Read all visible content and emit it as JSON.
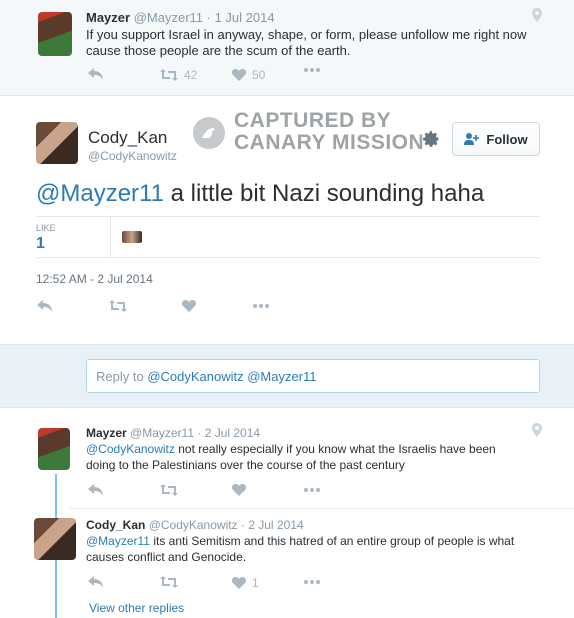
{
  "top_tweet": {
    "name": "Mayzer",
    "handle": "@Mayzer11",
    "date": "· 1 Jul 2014",
    "text_line1": "If you support Israel in anyway, shape, or form, please unfollow me right now",
    "text_line2": "cause those people are the scum of the earth.",
    "retweets": "42",
    "likes": "50"
  },
  "main_tweet": {
    "name": "Cody_Kan",
    "handle": "@CodyKanowitz",
    "watermark_line1": "CAPTURED BY",
    "watermark_line2": "CANARY MISSION",
    "follow_label": "Follow",
    "mention": "@Mayzer11",
    "text": " a little bit Nazi sounding haha",
    "like_label": "LIKE",
    "like_count": "1",
    "timestamp": "12:52 AM - 2 Jul 2014"
  },
  "reply_box": {
    "prefix": "Reply to ",
    "mentions": "@CodyKanowitz @Mayzer11"
  },
  "reply1": {
    "name": "Mayzer",
    "handle": "@Mayzer11",
    "date": "· 2 Jul 2014",
    "mention": "@CodyKanowitz",
    "text_line1": " not really especially if you know what the Israelis have been",
    "text_line2": "doing to the Palestinians over the course of the past century"
  },
  "reply2": {
    "name": "Cody_Kan",
    "handle": "@CodyKanowitz",
    "date": "· 2 Jul 2014",
    "mention": "@Mayzer11",
    "text_line1": " its anti Semitism and this hatred of an entire group of people is what",
    "text_line2": "causes conflict and Genocide.",
    "likes": "1"
  },
  "view_other_replies": "View other replies",
  "icons": [
    "reply-icon",
    "retweet-icon",
    "heart-icon",
    "more-icon",
    "location-pin-icon",
    "gear-icon",
    "follow-person-icon"
  ],
  "colors": {
    "link": "#2b7bb9",
    "muted": "#8899a6",
    "icon": "#aab8c2",
    "reply_bg": "#e8f1f7",
    "thread_line": "#7fc1e8"
  }
}
